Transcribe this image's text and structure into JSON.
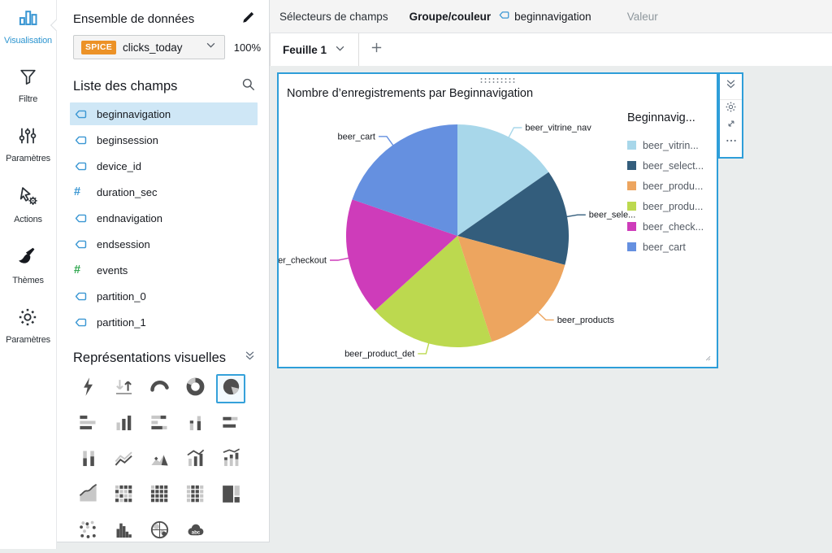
{
  "rail": {
    "items": [
      {
        "label": "Visualisation",
        "icon": "bar-chart",
        "active": true
      },
      {
        "label": "Filtre",
        "icon": "funnel",
        "active": false
      },
      {
        "label": "Paramètres",
        "icon": "sliders",
        "active": false
      },
      {
        "label": "Actions",
        "icon": "cursor-gear",
        "active": false
      },
      {
        "label": "Thèmes",
        "icon": "brush",
        "active": false
      },
      {
        "label": "Paramètres",
        "icon": "gear",
        "active": false
      }
    ]
  },
  "panel": {
    "dataset_title": "Ensemble de données",
    "spice_badge": "SPICE",
    "dataset_name": "clicks_today",
    "capacity": "100%",
    "fields_title": "Liste des champs",
    "fields": [
      {
        "name": "beginnavigation",
        "type": "dimension",
        "selected": true
      },
      {
        "name": "beginsession",
        "type": "dimension",
        "selected": false
      },
      {
        "name": "device_id",
        "type": "dimension",
        "selected": false
      },
      {
        "name": "duration_sec",
        "type": "number",
        "selected": false
      },
      {
        "name": "endnavigation",
        "type": "dimension",
        "selected": false
      },
      {
        "name": "endsession",
        "type": "dimension",
        "selected": false
      },
      {
        "name": "events",
        "type": "measure",
        "selected": false
      },
      {
        "name": "partition_0",
        "type": "dimension",
        "selected": false
      },
      {
        "name": "partition_1",
        "type": "dimension",
        "selected": false
      }
    ],
    "visuals_title": "Représentations visuelles",
    "visual_types": [
      "flash",
      "kpi",
      "gauge",
      "donut",
      "pie",
      "hbar",
      "vbar",
      "hbar-stacked",
      "vbar-stacked",
      "hbar2",
      "waterfall",
      "line",
      "area-peak",
      "combo-bar-line",
      "combo-stacked-line",
      "area",
      "heatmap",
      "pivot-table",
      "table",
      "treemap",
      "scatter",
      "histogram",
      "map",
      "word-cloud"
    ],
    "selected_visual": "pie"
  },
  "field_wells": {
    "title": "Sélecteurs de champs",
    "group_label": "Groupe/couleur",
    "group_field": "beginnavigation",
    "value_label": "Valeur"
  },
  "tabs": {
    "active": "Feuille 1"
  },
  "visual_toolbar": {
    "icons": [
      "collapse-icon",
      "gear-icon",
      "expand-icon",
      "menu-icon"
    ]
  },
  "chart_data": {
    "type": "pie",
    "title": "Nombre d’enregistrements par Beginnavigation",
    "group_by_field": "beginnavigation",
    "legend_title": "Beginnavig...",
    "legend_position": "right",
    "value_labels_shown": false,
    "slices": [
      {
        "callout_label": "beer_vitrine_nav",
        "legend_label": "beer_vitrin...",
        "percent_estimate": 15.3,
        "color": "#a8d7ea"
      },
      {
        "callout_label": "beer_sele...",
        "legend_label": "beer_select...",
        "percent_estimate": 13.9,
        "color": "#335d7c"
      },
      {
        "callout_label": "beer_products",
        "legend_label": "beer_produ...",
        "percent_estimate": 15.8,
        "color": "#eda55f"
      },
      {
        "callout_label": "beer_product_det",
        "legend_label": "beer_produ...",
        "percent_estimate": 18.3,
        "color": "#bcd94f"
      },
      {
        "callout_label": "er_checkout",
        "legend_label": "beer_check...",
        "percent_estimate": 17.0,
        "color": "#ce3cba"
      },
      {
        "callout_label": "beer_cart",
        "legend_label": "beer_cart",
        "percent_estimate": 19.7,
        "color": "#6590e0"
      }
    ],
    "colors": {
      "accent_blue": "#2e9ed9",
      "spice_orange": "#ec9227",
      "field_icon_blue": "#3b97d3",
      "measure_green": "#33a852",
      "selected_field_bg": "#cfe7f6"
    }
  }
}
